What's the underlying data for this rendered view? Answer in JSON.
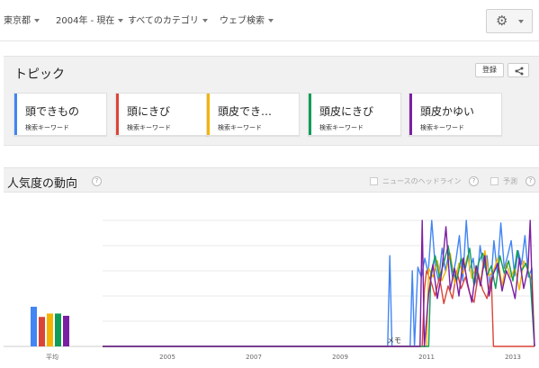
{
  "filters": [
    {
      "label": "東京都"
    },
    {
      "label": "2004年 - 現在"
    },
    {
      "label": "すべてのカテゴリ"
    },
    {
      "label": "ウェブ検索"
    }
  ],
  "topics": {
    "title": "トピック",
    "register_label": "登録",
    "share_icon": "share-icon",
    "cards": [
      {
        "term": "頭できもの",
        "kind": "検索キーワード",
        "color": "#4285f4"
      },
      {
        "term": "頭にきび",
        "kind": "検索キーワード",
        "color": "#db4437"
      },
      {
        "term": "頭皮でき…",
        "kind": "検索キーワード",
        "color": "#f4b400"
      },
      {
        "term": "頭皮にきび",
        "kind": "検索キーワード",
        "color": "#0f9d58"
      },
      {
        "term": "頭皮かゆい",
        "kind": "検索キーワード",
        "color": "#7b1fa2"
      }
    ]
  },
  "interest": {
    "title": "人気度の動向",
    "help": "?",
    "news_label": "ニュースのヘッドライン",
    "forecast_label": "予測"
  },
  "chart_data": {
    "type": "line",
    "average_label": "平均",
    "annotation": "メモ",
    "x_ticks": [
      "2005",
      "2007",
      "2009",
      "2011",
      "2013"
    ],
    "x_range": [
      2004.0,
      2014.0
    ],
    "y_range": [
      0,
      100
    ],
    "grid": true,
    "averages": [
      {
        "name": "頭できもの",
        "value": 35
      },
      {
        "name": "頭にきび",
        "value": 26
      },
      {
        "name": "頭皮でき…",
        "value": 29
      },
      {
        "name": "頭皮にきび",
        "value": 29
      },
      {
        "name": "頭皮かゆい",
        "value": 27
      }
    ],
    "series": [
      {
        "name": "頭できもの",
        "color": "#4285f4",
        "x": [
          2004.0,
          2010.6,
          2010.65,
          2010.7,
          2011.12,
          2011.17,
          2011.22,
          2011.3,
          2011.38,
          2011.46,
          2011.54,
          2011.62,
          2011.7,
          2011.78,
          2011.86,
          2011.94,
          2012.02,
          2012.1,
          2012.18,
          2012.26,
          2012.34,
          2012.42,
          2012.5,
          2012.58,
          2012.66,
          2012.74,
          2012.82,
          2012.9,
          2012.98,
          2013.06,
          2013.14,
          2013.22,
          2013.3,
          2013.38,
          2013.46,
          2013.54,
          2013.62,
          2013.7,
          2013.78,
          2013.86,
          2013.94,
          2014.0
        ],
        "y": [
          0,
          0,
          72,
          0,
          0,
          60,
          0,
          63,
          55,
          70,
          58,
          100,
          64,
          52,
          78,
          60,
          75,
          55,
          68,
          88,
          52,
          100,
          60,
          70,
          48,
          80,
          62,
          72,
          45,
          84,
          58,
          98,
          62,
          72,
          84,
          56,
          76,
          65,
          88,
          55,
          62,
          0
        ]
      },
      {
        "name": "頭にきび",
        "color": "#db4437",
        "x": [
          2004.0,
          2011.4,
          2011.45,
          2011.5,
          2011.6,
          2011.7,
          2011.8,
          2011.9,
          2012.0,
          2012.1,
          2012.2,
          2012.3,
          2012.4,
          2012.5,
          2012.6,
          2012.7,
          2012.8,
          2012.9,
          2013.0,
          2013.05,
          2013.1,
          2014.0
        ],
        "y": [
          0,
          0,
          45,
          60,
          52,
          40,
          55,
          34,
          48,
          38,
          60,
          46,
          55,
          42,
          35,
          58,
          45,
          38,
          55,
          0,
          0,
          0
        ]
      },
      {
        "name": "頭皮でき…",
        "color": "#f4b400",
        "x": [
          2004.0,
          2011.5,
          2011.55,
          2011.65,
          2011.75,
          2011.85,
          2011.95,
          2012.05,
          2012.15,
          2012.25,
          2012.35,
          2012.45,
          2012.55,
          2012.65,
          2012.75,
          2012.85,
          2012.95,
          2013.05,
          2013.15,
          2013.25,
          2013.35,
          2013.45,
          2013.55,
          2013.65,
          2013.75,
          2013.85,
          2013.95,
          2014.0
        ],
        "y": [
          0,
          0,
          62,
          55,
          68,
          52,
          60,
          74,
          50,
          66,
          58,
          72,
          54,
          64,
          50,
          76,
          56,
          60,
          70,
          48,
          66,
          55,
          62,
          45,
          68,
          60,
          52,
          0
        ]
      },
      {
        "name": "頭皮にきび",
        "color": "#0f9d58",
        "x": [
          2004.0,
          2011.55,
          2011.6,
          2011.7,
          2011.8,
          2011.9,
          2012.0,
          2012.1,
          2012.2,
          2012.3,
          2012.4,
          2012.5,
          2012.6,
          2012.7,
          2012.8,
          2012.9,
          2013.0,
          2013.1,
          2013.2,
          2013.3,
          2013.4,
          2013.5,
          2013.6,
          2013.7,
          2013.8,
          2013.9,
          2014.0
        ],
        "y": [
          0,
          0,
          58,
          72,
          55,
          66,
          80,
          60,
          52,
          70,
          62,
          78,
          48,
          66,
          74,
          56,
          64,
          46,
          72,
          58,
          68,
          52,
          76,
          60,
          66,
          54,
          0
        ]
      },
      {
        "name": "頭皮かゆい",
        "color": "#7b1fa2",
        "x": [
          2004.0,
          2011.35,
          2011.4,
          2011.45,
          2011.55,
          2011.65,
          2011.75,
          2011.85,
          2011.95,
          2012.05,
          2012.15,
          2012.25,
          2012.35,
          2012.45,
          2012.55,
          2012.65,
          2012.75,
          2012.85,
          2012.95,
          2013.05,
          2013.15,
          2013.25,
          2013.35,
          2013.45,
          2013.55,
          2013.65,
          2013.75,
          2013.85,
          2013.9,
          2013.95,
          2014.0
        ],
        "y": [
          0,
          0,
          100,
          0,
          42,
          65,
          38,
          58,
          95,
          45,
          62,
          40,
          70,
          50,
          35,
          64,
          48,
          72,
          40,
          58,
          66,
          44,
          60,
          52,
          38,
          70,
          46,
          62,
          100,
          40,
          0
        ]
      }
    ]
  }
}
